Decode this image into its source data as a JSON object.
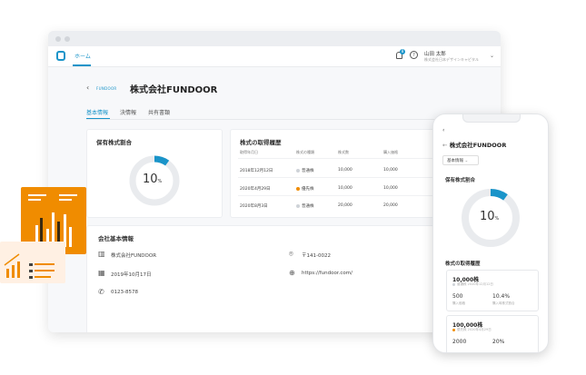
{
  "navbar": {
    "home_label": "ホーム",
    "notification_count": "8",
    "help": "?",
    "user_name": "山田 太郎",
    "user_company": "株式会社日本デザインキャピタル",
    "chevron": "⌄"
  },
  "page": {
    "back": "‹",
    "logo_text": "FUNDOOR",
    "title": "株式会社FUNDOOR",
    "tabs": [
      {
        "label": "基本情報",
        "active": true
      },
      {
        "label": "決情報",
        "active": false
      },
      {
        "label": "共有書類",
        "active": false
      }
    ]
  },
  "holding_card": {
    "title": "保有株式割合",
    "percent_value": "10",
    "percent_unit": "%",
    "fraction": 0.1
  },
  "history_card": {
    "title": "株式の取得履歴",
    "columns": [
      "取得年月日",
      "株式の種類",
      "株式数",
      "購入価格"
    ],
    "rows": [
      {
        "date": "2018年12月12日",
        "type": "普通株",
        "type_color": "#cfd3d8",
        "shares": "10,000",
        "price": "10,000"
      },
      {
        "date": "2020年4月29日",
        "type": "優先株",
        "type_color": "#f08c00",
        "shares": "10,000",
        "price": "10,000"
      },
      {
        "date": "2020年8月3日",
        "type": "普通株",
        "type_color": "#cfd3d8",
        "shares": "20,000",
        "price": "20,000"
      }
    ]
  },
  "company_info": {
    "title": "会社基本情報",
    "name": "株式会社FUNDOOR",
    "postal": "〒141-0022",
    "founded": "2019年10月17日",
    "url": "https://fundoor.com/",
    "phone": "0123-8578"
  },
  "mobile": {
    "back": "‹",
    "title_prefix": "←",
    "title": "株式会社FUNDOOR",
    "select_label": "基本情報",
    "select_chevron": "⌄",
    "holding_title": "保有株式割合",
    "percent_value": "10",
    "percent_unit": "%",
    "history_title": "株式の取得履歴",
    "cards": [
      {
        "shares": "10,000株",
        "sub": "普通株 2020年12月12日",
        "sub_color": "#cfd3d8",
        "val1": "500",
        "lbl1": "購入価格",
        "val2": "10.4%",
        "lbl2": "購入時株式割合"
      },
      {
        "shares": "100,000株",
        "sub": "優先株 2020年4月29日",
        "sub_color": "#f08c00",
        "val1": "2000",
        "lbl1": "",
        "val2": "20%",
        "lbl2": ""
      }
    ]
  },
  "colors": {
    "accent": "#1a94c9",
    "orange": "#f08c00",
    "ring": "#e9ebee"
  }
}
